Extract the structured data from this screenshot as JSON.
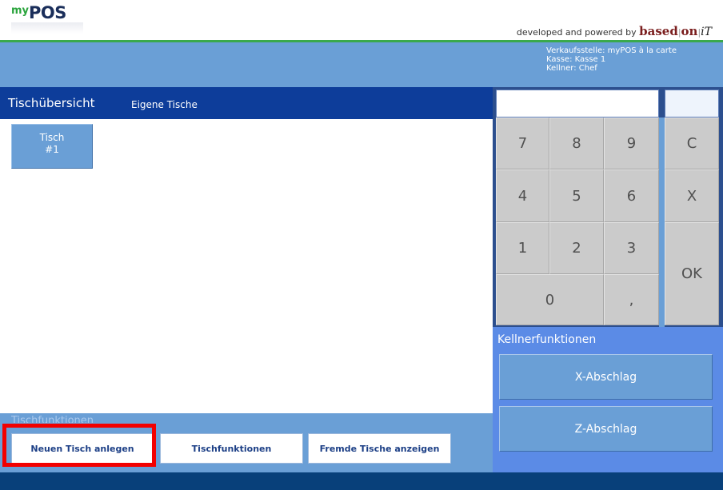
{
  "header": {
    "logo_my": "my",
    "logo_pos": "POS",
    "powered_prefix": "developed and powered by ",
    "powered_brand": "based",
    "powered_on": "on",
    "powered_it": "iT"
  },
  "info": {
    "store": "Verkaufsstelle: myPOS à la carte",
    "register": "Kasse: Kasse 1",
    "waiter": "Kellner: Chef"
  },
  "title": {
    "main": "Tischübersicht",
    "sub": "Eigene Tische"
  },
  "tables": [
    {
      "line1": "Tisch",
      "line2": "#1"
    }
  ],
  "functions": {
    "label": "Tischfunktionen",
    "buttons": [
      "Neuen Tisch anlegen",
      "Tischfunktionen",
      "Fremde Tische anzeigen"
    ]
  },
  "keypad": {
    "display_value": "",
    "side_display_value": "",
    "keys": {
      "k7": "7",
      "k8": "8",
      "k9": "9",
      "clear": "C",
      "k4": "4",
      "k5": "5",
      "k6": "6",
      "cancel": "X",
      "k1": "1",
      "k2": "2",
      "k3": "3",
      "ok": "OK",
      "k0": "0",
      "comma": ","
    }
  },
  "kellner": {
    "title": "Kellnerfunktionen",
    "buttons": [
      "X-Abschlag",
      "Z-Abschlag"
    ]
  },
  "colors": {
    "accent_blue": "#0d3d9a",
    "panel_blue": "#6a9fd6",
    "highlight_red": "#f20000",
    "brand_green": "#3aa94c"
  }
}
